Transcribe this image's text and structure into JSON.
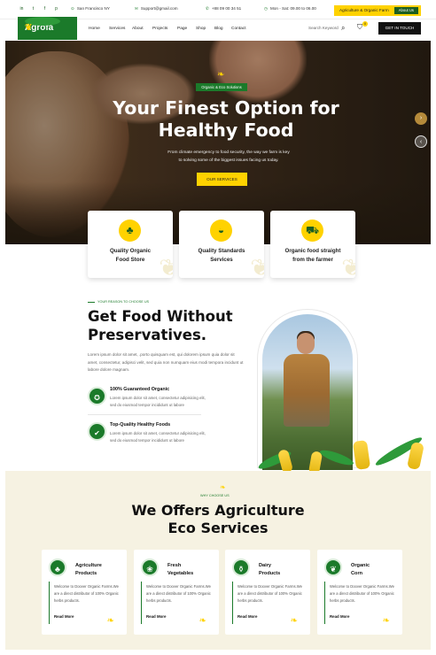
{
  "topbar": {
    "social": [
      "in",
      "t",
      "f",
      "p"
    ],
    "location": "San Francisco NY",
    "email": "Support@gmail.com",
    "phone": "+88 09 00 34 51",
    "hours": "Mon - Sat: 09.00 to 06.00",
    "promo": "Agriculture & Organic Farm",
    "about_button": "About Us"
  },
  "nav": {
    "logo": "Agrofa",
    "items": [
      "Home",
      "Services",
      "About",
      "Projects",
      "Page",
      "Shop",
      "Blog",
      "Contact"
    ],
    "search_placeholder": "Search Keyword",
    "cart_count": "0",
    "cta": "GET IN TOUCH"
  },
  "hero": {
    "badge": "Organic & Eco Solutions",
    "title_line1": "Your Finest Option for",
    "title_line2": "Healthy Food",
    "sub_line1": "From climate emergency to food security, the way we farm is key",
    "sub_line2": "to solving some of the biggest issues facing us today.",
    "button": "OUR SERVICES"
  },
  "features": [
    {
      "line1": "Quality Organic",
      "line2": "Food Store"
    },
    {
      "line1": "Quality Standards",
      "line2": "Services"
    },
    {
      "line1": "Organic food straight",
      "line2": "from the farmer"
    }
  ],
  "about": {
    "kicker": "YOUR REASON TO CHOOSE US",
    "title_line1": "Get Food Without",
    "title_line2": "Preservatives.",
    "text": "Lorem ipsum dolor sit amet, .porto quisquam est, qui dolorem ipsum quia dolor sit amet, consectetur, adipisci velit, sed quia non numquam eius modi tempora incidunt ut labore dolore magnam.",
    "points": [
      {
        "title": "100% Guaranteed Organic",
        "desc": "Lorem ipsum dolor sit amet, consectetur adipisicing elit, sed do eiusmod tempor incididunt ut labore"
      },
      {
        "title": "Top-Quality Healthy Foods",
        "desc": "Lorem ipsum dolor sit amet, consectetur adipisicing elit, sed do eiusmod tempor incididunt ut labore"
      }
    ]
  },
  "services": {
    "kicker": "WHY CHOOSE US",
    "title_line1": "We Offers Agriculture",
    "title_line2": "Eco Services",
    "cards": [
      {
        "line1": "Agriculture",
        "line2": "Products",
        "desc": "Welcome to Doover Organic Farms.We are a direct distributor of 100% Organic herbs products.",
        "link": "Read More"
      },
      {
        "line1": "Fresh",
        "line2": "Vegetables",
        "desc": "Welcome to Doover Organic Farms.We are a direct distributor of 100% Organic herbs products.",
        "link": "Read More"
      },
      {
        "line1": "Dairy",
        "line2": "Products",
        "desc": "Welcome to Doover Organic Farms.We are a direct distributor of 100% Organic herbs products.",
        "link": "Read More"
      },
      {
        "line1": "Organic",
        "line2": "Corn",
        "desc": "Welcome to Doover Organic Farms.We are a direct distributor of 100% Organic herbs products.",
        "link": "Read More"
      }
    ]
  },
  "colors": {
    "primary": "#1b7a2a",
    "accent": "#ffd200",
    "cream": "#f6f2e2"
  }
}
